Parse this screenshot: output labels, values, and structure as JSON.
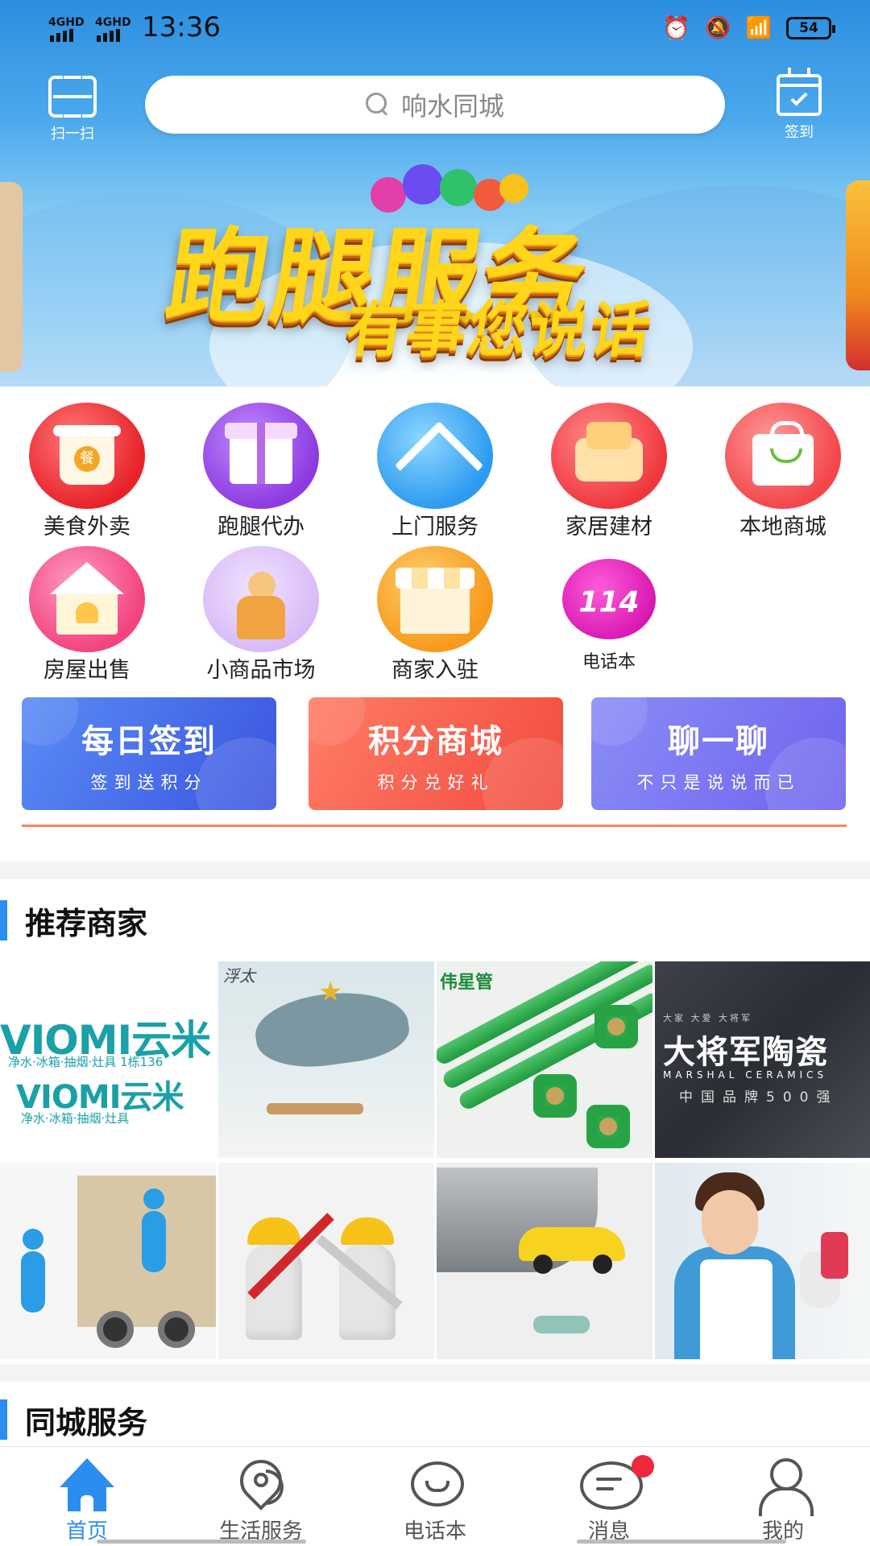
{
  "status_bar": {
    "sim1": "4GHD",
    "sim2": "4GHD",
    "time": "13:36",
    "battery": "54"
  },
  "header": {
    "scan_label": "扫一扫",
    "search_placeholder": "响水同城",
    "checkin_label": "签到"
  },
  "banner": {
    "title": "跑腿服务",
    "subtitle": "有事您说话",
    "slide_count": 3,
    "active_slide": 3
  },
  "menu": {
    "items": [
      {
        "label": "美食外卖",
        "icon": "takeout-cup-icon"
      },
      {
        "label": "跑腿代办",
        "icon": "package-box-icon"
      },
      {
        "label": "上门服务",
        "icon": "home-cleaning-icon"
      },
      {
        "label": "家居建材",
        "icon": "sofa-icon"
      },
      {
        "label": "本地商城",
        "icon": "shopping-bag-icon"
      },
      {
        "label": "房屋出售",
        "icon": "house-icon"
      },
      {
        "label": "小商品市场",
        "icon": "figure-icon"
      },
      {
        "label": "商家入驻",
        "icon": "storefront-icon"
      },
      {
        "label": "电话本",
        "icon": "phonebook-114-icon",
        "badge_text": "114"
      }
    ]
  },
  "promo_cards": [
    {
      "title": "每日签到",
      "subtitle": "签到送积分"
    },
    {
      "title": "积分商城",
      "subtitle": "积分兑好礼"
    },
    {
      "title": "聊一聊",
      "subtitle": "不只是说说而已"
    }
  ],
  "recommended": {
    "title": "推荐商家",
    "tiles": {
      "viomi": {
        "line1": "VIOMI云米",
        "line2": "净水·冰箱·抽烟·灶具 1栋136",
        "line3": "VIOMI云米",
        "line4": "净水·冰箱·抽烟·灶具"
      },
      "whale": {
        "brand": "浮太"
      },
      "pipe": {
        "logo": "伟星管"
      },
      "ceramics": {
        "top": "大家  大爱  大将军",
        "name": "大将军陶瓷",
        "en": "MARSHAL CERAMICS",
        "cn": "中国品牌500强"
      }
    }
  },
  "city_service": {
    "title": "同城服务"
  },
  "tabbar": {
    "items": [
      {
        "label": "首页",
        "active": true
      },
      {
        "label": "生活服务",
        "active": false
      },
      {
        "label": "电话本",
        "active": false
      },
      {
        "label": "消息",
        "active": false,
        "has_dot": true
      },
      {
        "label": "我的",
        "active": false
      }
    ]
  },
  "colors": {
    "accent": "#2b8df0",
    "promo_blue": "#3a54e0",
    "promo_red": "#f24a3e",
    "promo_violet": "#6e63ee",
    "badge_red": "#f0283c"
  }
}
